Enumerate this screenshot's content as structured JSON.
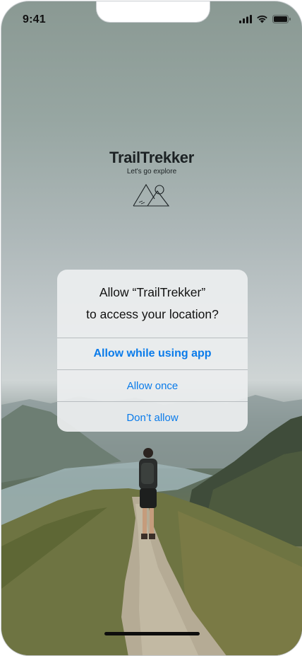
{
  "status_bar": {
    "time": "9:41"
  },
  "app": {
    "name": "TrailTrekker",
    "tagline": "Let's go explore"
  },
  "dialog": {
    "title_line1": "Allow “TrailTrekker”",
    "title_line2": "to access your location?",
    "buttons": {
      "allow_while_using": "Allow while using app",
      "allow_once": "Allow once",
      "dont_allow": "Don’t allow"
    }
  },
  "colors": {
    "accent": "#0a7bea"
  },
  "icons": {
    "signal": "cellular-signal-icon",
    "wifi": "wifi-icon",
    "battery": "battery-icon",
    "logo": "mountains-sun-icon"
  }
}
